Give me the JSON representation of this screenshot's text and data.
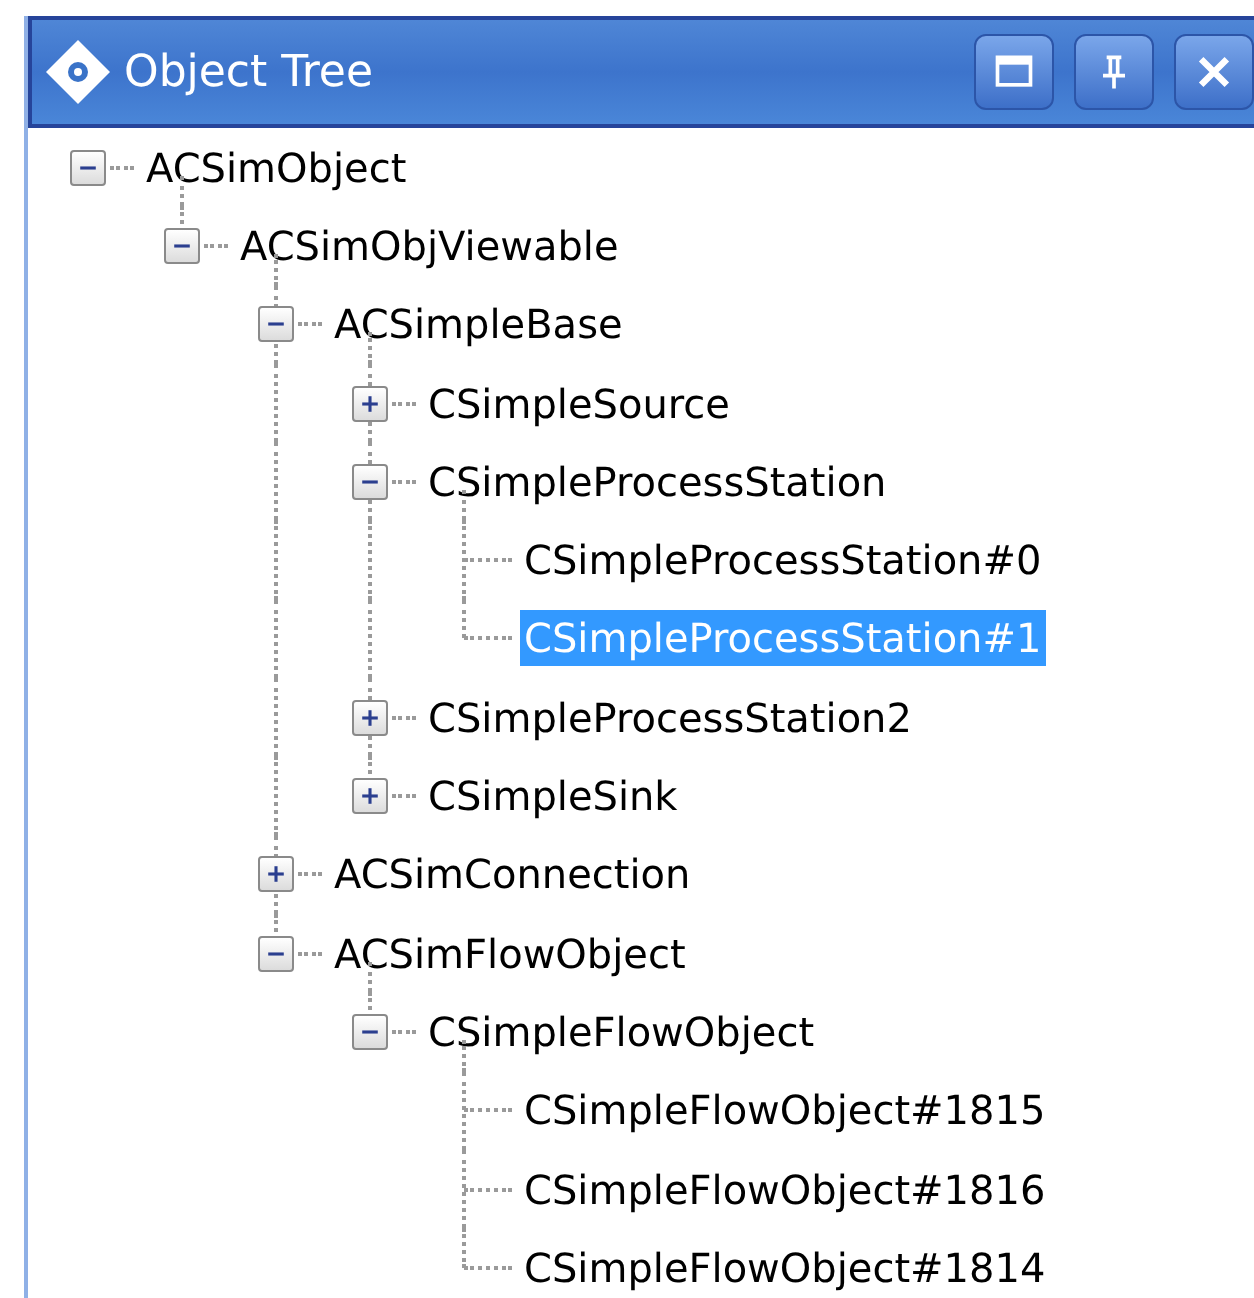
{
  "window": {
    "title": "Object Tree"
  },
  "tree": [
    {
      "label": "ACSimObject",
      "expanded": true,
      "selected": false,
      "children": [
        {
          "label": "ACSimObjViewable",
          "expanded": true,
          "selected": false,
          "children": [
            {
              "label": "ACSimpleBase",
              "expanded": true,
              "selected": false,
              "children": [
                {
                  "label": "CSimpleSource",
                  "expanded": false,
                  "selected": false
                },
                {
                  "label": "CSimpleProcessStation",
                  "expanded": true,
                  "selected": false,
                  "children": [
                    {
                      "label": "CSimpleProcessStation#0",
                      "selected": false
                    },
                    {
                      "label": "CSimpleProcessStation#1",
                      "selected": true
                    }
                  ]
                },
                {
                  "label": "CSimpleProcessStation2",
                  "expanded": false,
                  "selected": false
                },
                {
                  "label": "CSimpleSink",
                  "expanded": false,
                  "selected": false
                }
              ]
            },
            {
              "label": "ACSimConnection",
              "expanded": false,
              "selected": false
            },
            {
              "label": "ACSimFlowObject",
              "expanded": true,
              "selected": false,
              "children": [
                {
                  "label": "CSimpleFlowObject",
                  "expanded": true,
                  "selected": false,
                  "children": [
                    {
                      "label": "CSimpleFlowObject#1815",
                      "selected": false
                    },
                    {
                      "label": "CSimpleFlowObject#1816",
                      "selected": false
                    },
                    {
                      "label": "CSimpleFlowObject#1814",
                      "selected": false
                    }
                  ]
                }
              ]
            }
          ]
        }
      ]
    }
  ]
}
